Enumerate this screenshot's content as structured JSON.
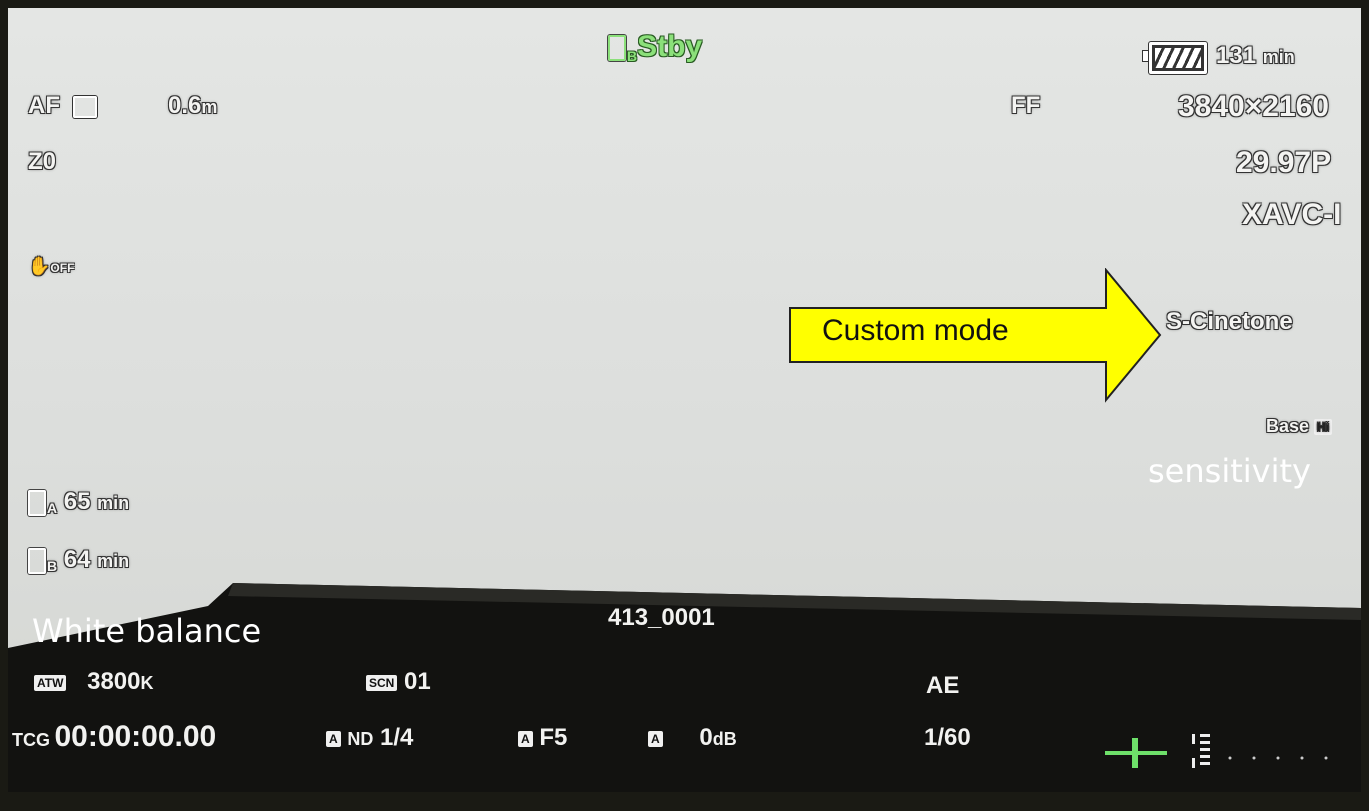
{
  "status": {
    "card_label": "B",
    "state": "Stby"
  },
  "battery": {
    "remaining": "131",
    "unit": "min"
  },
  "focus": {
    "mode": "AF",
    "distance": "0.6",
    "unit": "m"
  },
  "zoom": {
    "value": "Z0"
  },
  "stabilizer": {
    "label": "OFF"
  },
  "format": {
    "sensor": "FF",
    "resolution": "3840×2160",
    "frame_rate": "29.97P",
    "codec": "XAVC-I"
  },
  "picture_profile": "S-Cinetone",
  "base_iso": {
    "label": "Base",
    "badge": "Hi"
  },
  "media": [
    {
      "slot": "A",
      "remaining": "65",
      "unit": "min"
    },
    {
      "slot": "B",
      "remaining": "64",
      "unit": "min"
    }
  ],
  "clip_name": "413_0001",
  "white_balance": {
    "mode": "ATW",
    "value": "3800",
    "unit": "K"
  },
  "scene": {
    "badge": "SCN",
    "value": "01"
  },
  "exposure_mode": "AE",
  "timecode": {
    "label": "TCG",
    "value": "00:00:00.00"
  },
  "nd": {
    "auto": "A",
    "label": "ND",
    "value": "1/4"
  },
  "iris": {
    "auto": "A",
    "value": "F5"
  },
  "gain": {
    "auto": "A",
    "value": "0",
    "unit": "dB"
  },
  "shutter": "1/60",
  "annotations": {
    "custom_mode": "Custom mode",
    "sensitivity": "sensitivity",
    "white_balance": "White balance"
  },
  "colors": {
    "status_green": "#8be07a",
    "annotation_yellow": "#ffff00"
  }
}
